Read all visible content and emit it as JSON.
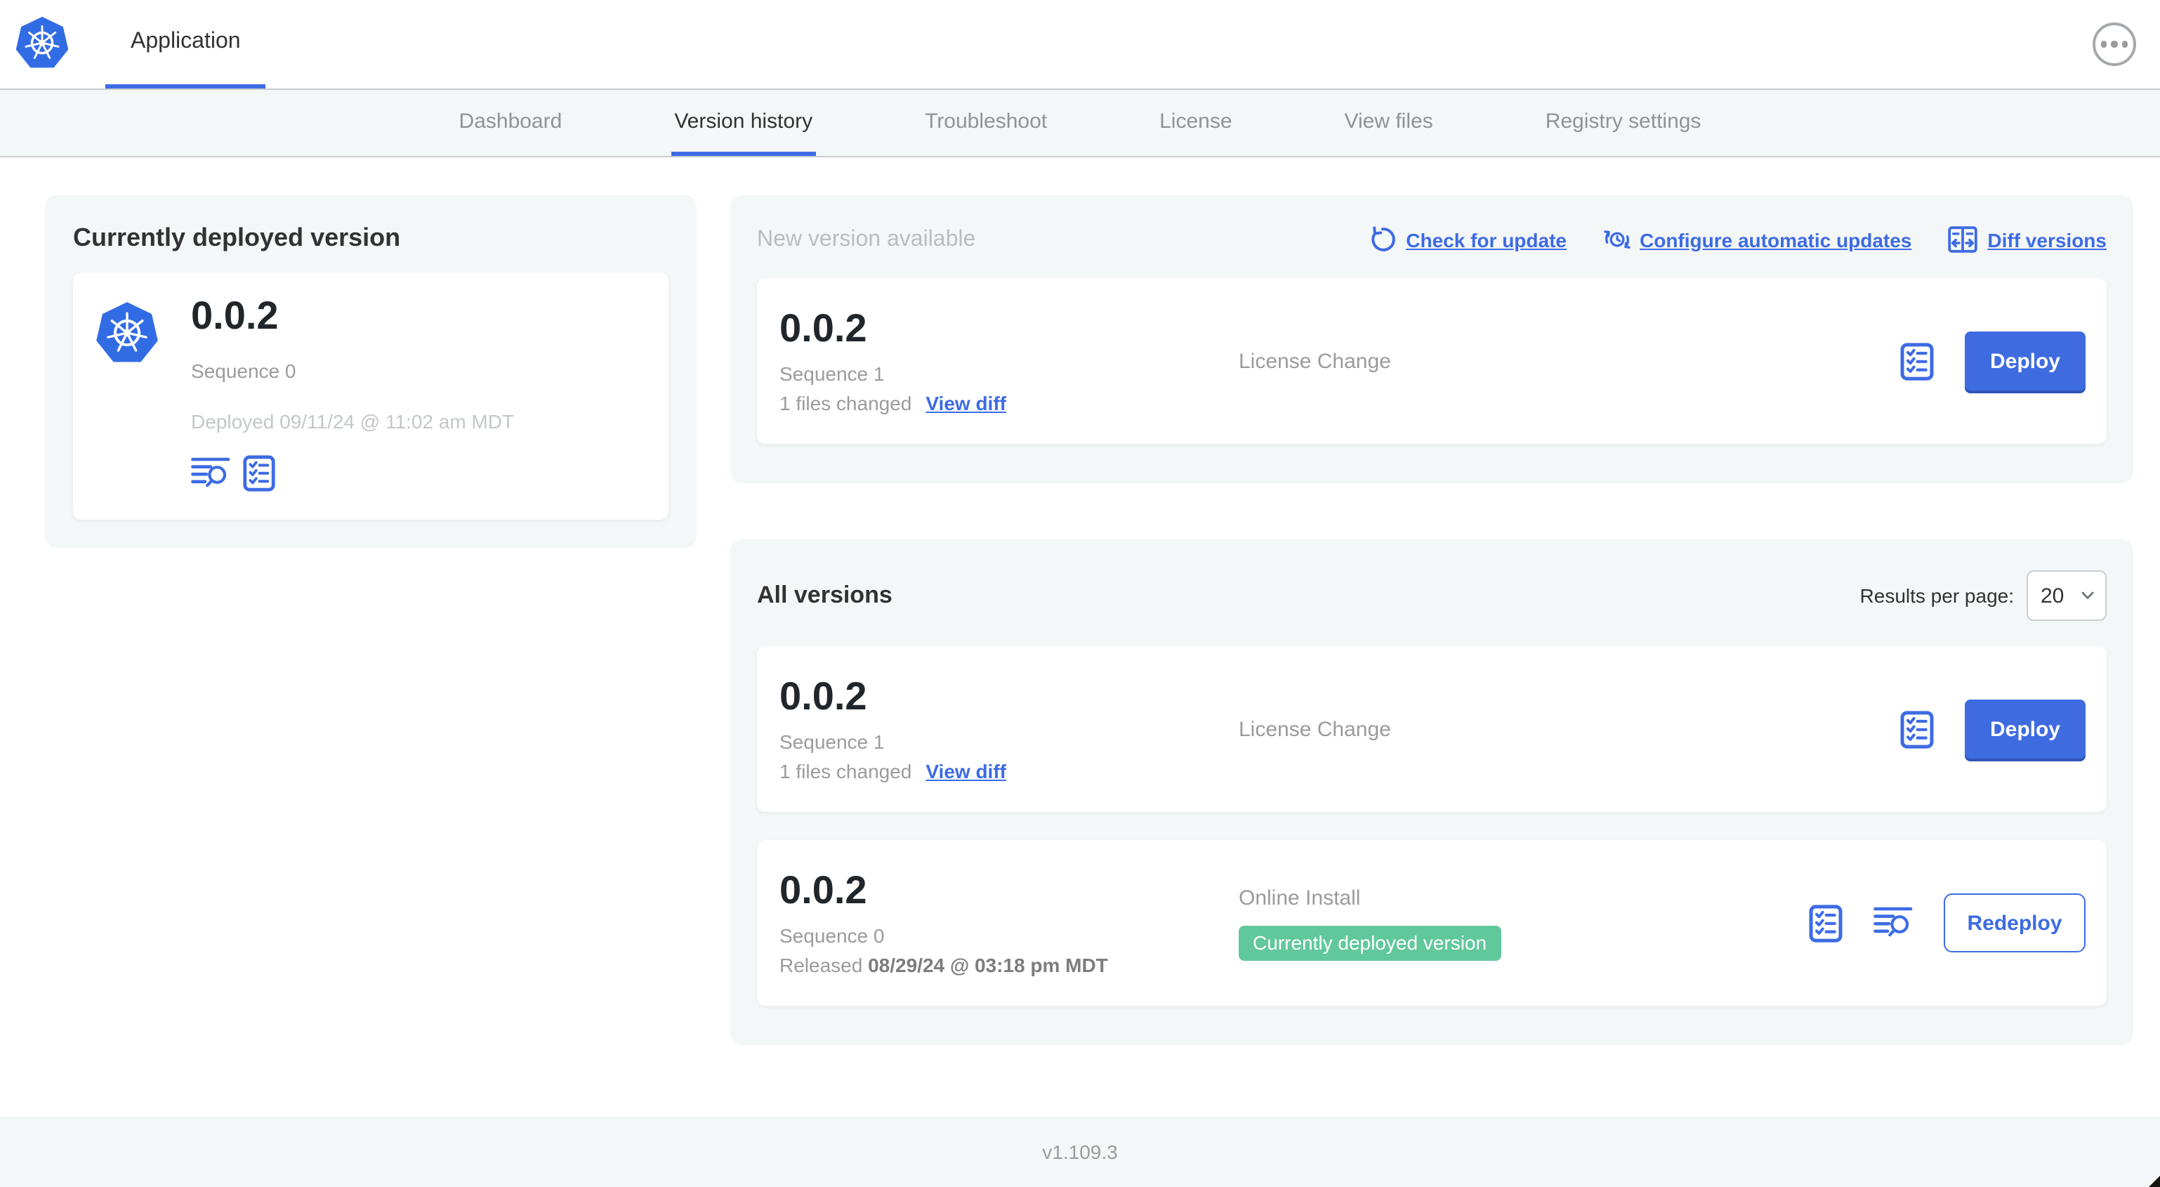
{
  "colors": {
    "accent_blue": "#3d6be4",
    "k8s_blue": "#326ce5",
    "badge_green": "#61c89b",
    "dark_text": "#323232",
    "grey_text": "#9b9b9b",
    "section_bg": "#f4f7f8"
  },
  "header": {
    "app_name": "Application",
    "logo_icon": "kubernetes-logo",
    "menu_icon": "ellipsis-menu-icon"
  },
  "nav": {
    "active_tab": "Version history",
    "tabs": [
      "Dashboard",
      "Version history",
      "Troubleshoot",
      "License",
      "View files",
      "Registry settings"
    ]
  },
  "current_version_card": {
    "title": "Currently deployed version",
    "version": "0.0.2",
    "sequence": "Sequence 0",
    "deployed": "Deployed 09/11/24 @ 11:02 am MDT",
    "icons": [
      "view-logs-icon",
      "view-config-icon"
    ]
  },
  "new_version_section": {
    "title": "New version available",
    "actions": [
      {
        "label": "Check for update",
        "icon": "refresh-icon"
      },
      {
        "label": "Configure automatic updates",
        "icon": "schedule-update-icon"
      },
      {
        "label": "Diff versions",
        "icon": "diff-icon"
      }
    ],
    "row": {
      "version": "0.0.2",
      "sequence": "Sequence 1",
      "files_changed": "1 files changed",
      "view_diff_label": "View diff",
      "source": "License Change",
      "config_icon": "view-config-icon",
      "action_label": "Deploy"
    }
  },
  "all_versions_section": {
    "title": "All versions",
    "results_per_page_label": "Results per page:",
    "results_per_page_value": "20",
    "rows": [
      {
        "version": "0.0.2",
        "sequence": "Sequence 1",
        "files_changed": "1 files changed",
        "view_diff_label": "View diff",
        "source": "License Change",
        "config_icon": "view-config-icon",
        "action_label": "Deploy"
      },
      {
        "version": "0.0.2",
        "sequence": "Sequence 0",
        "released_label": "Released",
        "released_date": "08/29/24 @ 03:18 pm MDT",
        "source": "Online Install",
        "badge": "Currently deployed version",
        "config_icon": "view-config-icon",
        "logs_icon": "view-logs-icon",
        "action_label": "Redeploy"
      }
    ]
  },
  "footer": {
    "app_version": "v1.109.3"
  }
}
